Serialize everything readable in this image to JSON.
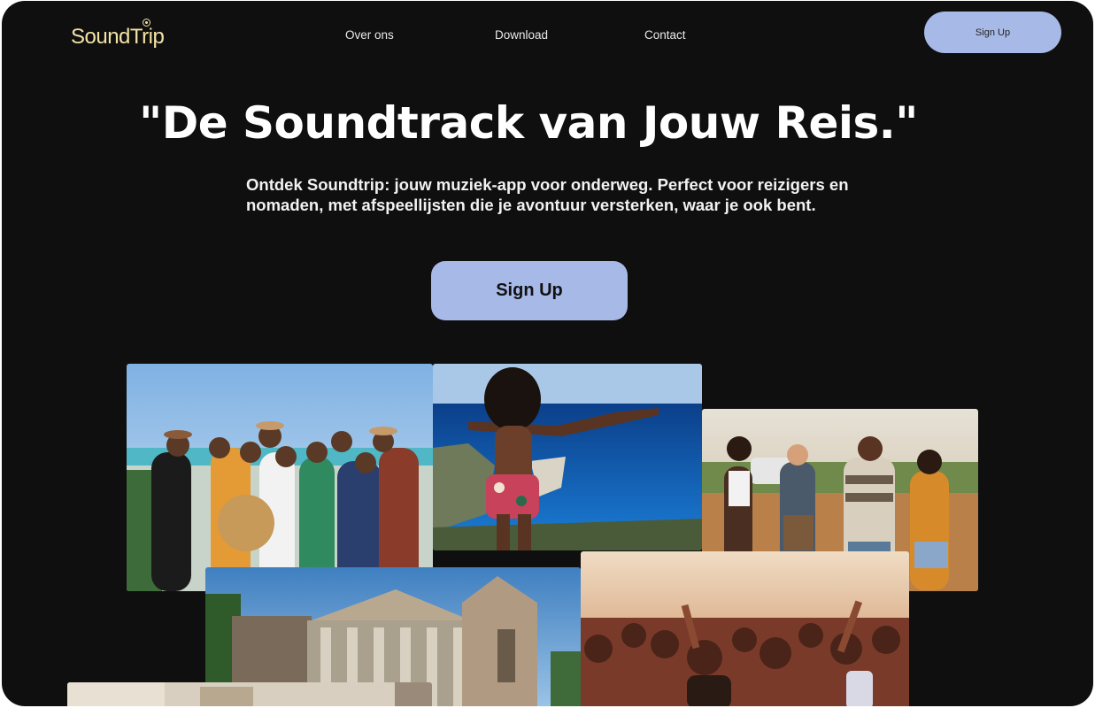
{
  "brand": {
    "name_a": "Sound",
    "name_b": "Trip"
  },
  "nav": {
    "items": [
      "Over ons",
      "Download",
      "Contact"
    ]
  },
  "header": {
    "signup_label": "Sign Up"
  },
  "hero": {
    "title": "\"De Soundtrack van Jouw Reis.\"",
    "description": "Ontdek Soundtrip: jouw muziek-app voor onderweg. Perfect voor reizigers en nomaden, met afspeellijsten die je avontuur versterken, waar je ook bent.",
    "cta_label": "Sign Up"
  },
  "colors": {
    "background": "#0f0f0f",
    "accent": "#a7b9e6",
    "logo": "#f3e2a6"
  },
  "gallery": [
    {
      "id": "group-beach-photo"
    },
    {
      "id": "cliff-sea-photo"
    },
    {
      "id": "friends-walking-photo"
    },
    {
      "id": "cathedral-photo"
    },
    {
      "id": "festival-crowd-photo"
    },
    {
      "id": "street-photo"
    }
  ]
}
